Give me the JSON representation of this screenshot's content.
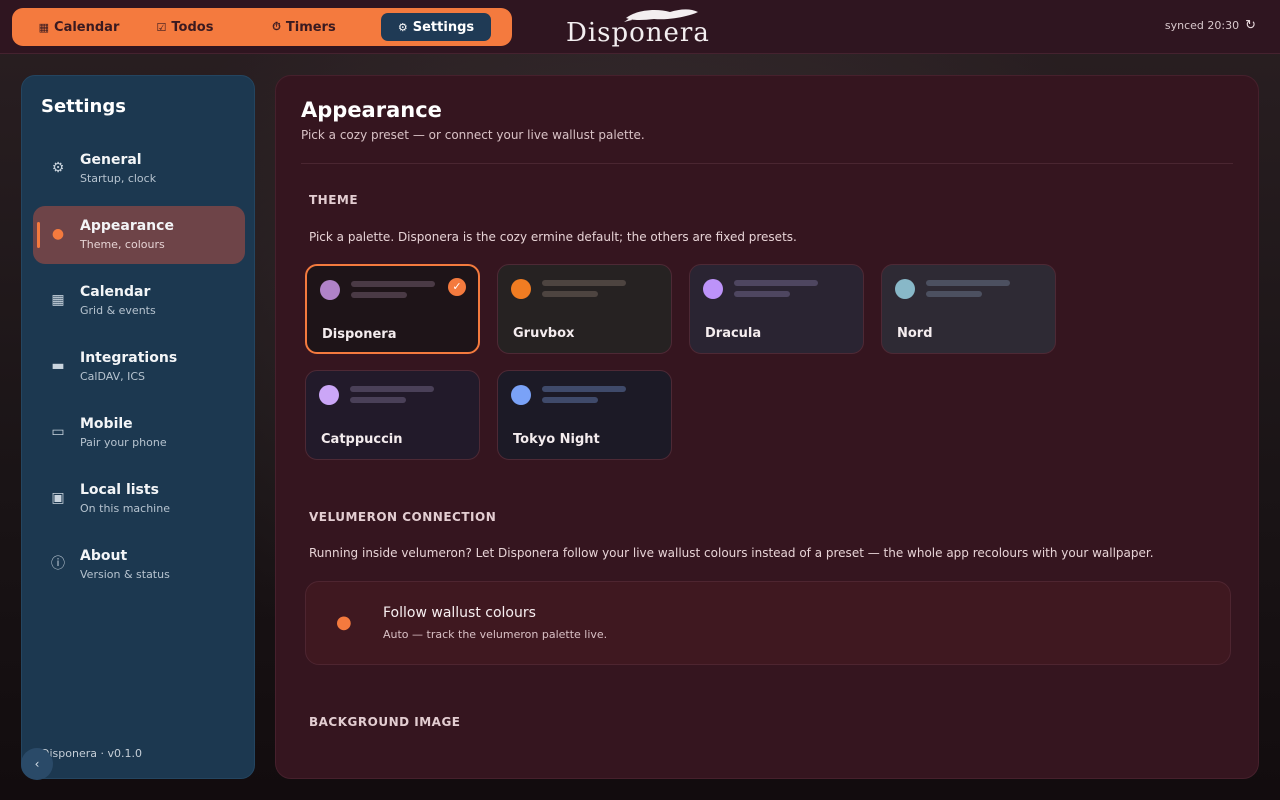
{
  "nav": {
    "tabs": [
      {
        "label": "Calendar",
        "icon": "calendar-icon"
      },
      {
        "label": "Todos",
        "icon": "check-square-icon"
      },
      {
        "label": "Timers",
        "icon": "stopwatch-icon"
      },
      {
        "label": "Settings",
        "icon": "gear-icon"
      }
    ],
    "active": "Settings"
  },
  "logo": {
    "text": "Disponera"
  },
  "sync": {
    "status": "synced 20:30"
  },
  "sidebar": {
    "title": "Settings",
    "items": [
      {
        "label": "General",
        "sub": "Startup, clock",
        "icon": "gear-icon"
      },
      {
        "label": "Appearance",
        "sub": "Theme, colours",
        "icon": "palette-icon"
      },
      {
        "label": "Calendar",
        "sub": "Grid & events",
        "icon": "calendar-icon"
      },
      {
        "label": "Integrations",
        "sub": "CalDAV, ICS",
        "icon": "monitor-icon"
      },
      {
        "label": "Mobile",
        "sub": "Pair your phone",
        "icon": "car-icon"
      },
      {
        "label": "Local lists",
        "sub": "On this machine",
        "icon": "folder-plus-icon"
      },
      {
        "label": "About",
        "sub": "Version & status",
        "icon": "info-icon"
      }
    ],
    "active": "Appearance",
    "footer": "Disponera · v0.1.0"
  },
  "main": {
    "title": "Appearance",
    "subtitle": "Pick a cozy preset — or connect your live wallust palette.",
    "theme": {
      "heading": "THEME",
      "description": "Pick a palette. Disponera is the cozy ermine default; the others are fixed presets.",
      "presets": [
        {
          "name": "Disponera",
          "dot": "#b082c8",
          "bg": "#1e1418",
          "bar": "#4a3a45",
          "selected": true
        },
        {
          "name": "Gruvbox",
          "dot": "#f07c22",
          "bg": "#262222",
          "bar": "#4d4440",
          "selected": false
        },
        {
          "name": "Dracula",
          "dot": "#bd93f9",
          "bg": "#2a2432",
          "bar": "#4e4660",
          "selected": false
        },
        {
          "name": "Nord",
          "dot": "#88b8c8",
          "bg": "#2e2a34",
          "bar": "#4c5060",
          "selected": false
        },
        {
          "name": "Catppuccin",
          "dot": "#cba6f7",
          "bg": "#221a2a",
          "bar": "#4a4058",
          "selected": false
        },
        {
          "name": "Tokyo Night",
          "dot": "#7aa2f7",
          "bg": "#1c1a26",
          "bar": "#3f4a6a",
          "selected": false
        }
      ]
    },
    "velumeron": {
      "heading": "VELUMERON CONNECTION",
      "description": "Running inside velumeron? Let Disponera follow your live wallust colours instead of a preset — the whole app recolours with your wallpaper.",
      "card_title": "Follow wallust colours",
      "card_sub": "Auto — track the velumeron palette live.",
      "icon": "palette-icon"
    },
    "background": {
      "heading": "BACKGROUND IMAGE"
    }
  },
  "colors": {
    "accent": "#f47a3e",
    "sidebar": "#1c3850",
    "panel": "#35151f"
  }
}
